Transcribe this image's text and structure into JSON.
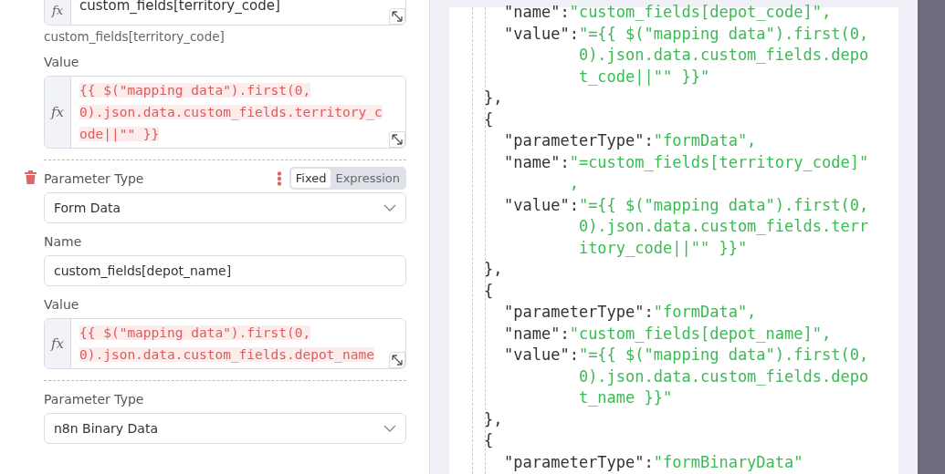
{
  "parameters": [
    {
      "hovered": false,
      "fields": [
        {
          "kind": "plain-expression",
          "gutter": "fx",
          "value": "custom_fields[territory_code]",
          "hint": "custom_fields[territory_code]"
        },
        {
          "kind": "expression",
          "label": "Value",
          "gutter": "fx",
          "value": "{{  $(\"mapping data\").first(0, 0).json.data.custom_fields.territory_code||\"\" }}"
        }
      ]
    },
    {
      "hovered": true,
      "fields": [
        {
          "kind": "select",
          "label": "Parameter Type",
          "value": "Form Data",
          "modes": [
            {
              "label": "Fixed",
              "selected": true
            },
            {
              "label": "Expression",
              "selected": false
            }
          ]
        },
        {
          "kind": "text",
          "label": "Name",
          "value": "custom_fields[depot_name]"
        },
        {
          "kind": "expression",
          "label": "Value",
          "gutter": "fx",
          "value": "{{ $(\"mapping data\").first(0, 0).json.data.custom_fields.depot_name"
        }
      ]
    },
    {
      "hovered": false,
      "fields": [
        {
          "kind": "select",
          "label": "Parameter Type",
          "value": "n8n Binary Data"
        }
      ]
    }
  ],
  "json_preview": {
    "lines": [
      {
        "kind": "pair",
        "key": "\"name\":",
        "value": "\"custom_fields[depot_code]\","
      },
      {
        "kind": "pair",
        "key": "\"value\":",
        "value": "\"={{ $(\"mapping data\").first(0, 0).json.data.custom_fields.depot_code||\"\" }}\""
      },
      {
        "kind": "brace",
        "text": "},"
      },
      {
        "kind": "brace",
        "text": "{"
      },
      {
        "kind": "pair",
        "key": "\"parameterType\":",
        "value": "\"formData\","
      },
      {
        "kind": "pair",
        "key": "\"name\":",
        "value": "\"=custom_fields[territory_code]\","
      },
      {
        "kind": "pair",
        "key": "\"value\":",
        "value": "\"={{ $(\"mapping data\").first(0, 0).json.data.custom_fields.territory_code||\"\" }}\""
      },
      {
        "kind": "brace",
        "text": "},"
      },
      {
        "kind": "brace",
        "text": "{"
      },
      {
        "kind": "pair",
        "key": "\"parameterType\":",
        "value": "\"formData\","
      },
      {
        "kind": "pair",
        "key": "\"name\":",
        "value": "\"custom_fields[depot_name]\","
      },
      {
        "kind": "pair",
        "key": "\"value\":",
        "value": "\"={{ $(\"mapping data\").first(0, 0).json.data.custom_fields.depot_name }}\""
      },
      {
        "kind": "brace",
        "text": "},"
      },
      {
        "kind": "brace",
        "text": "{"
      },
      {
        "kind": "pair",
        "key": "\"parameterType\":",
        "value": "\"formBinaryData\""
      }
    ]
  }
}
